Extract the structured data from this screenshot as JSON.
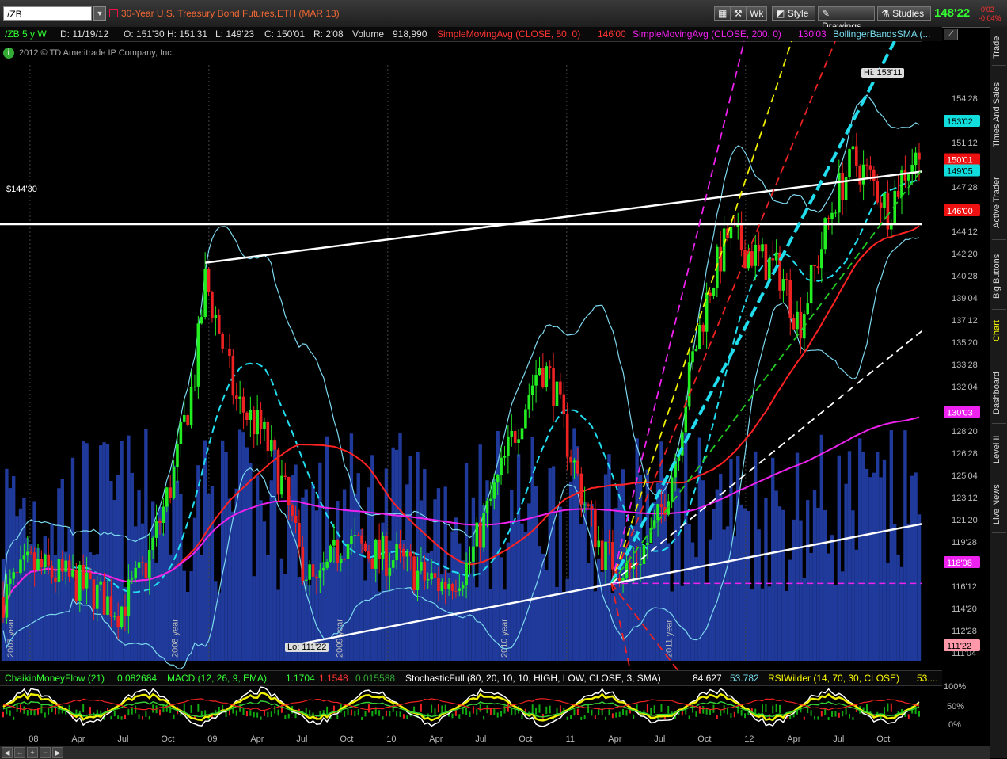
{
  "toolbar": {
    "symbol": "/ZB",
    "title": "30-Year U.S. Treasury Bond Futures,ETH (MAR 13)",
    "wk_label": "Wk",
    "style_label": "Style",
    "drawings_label": "Drawings",
    "studies_label": "Studies",
    "last_price": "148'22",
    "change_abs": "-0'02",
    "change_pct": "-0.04%"
  },
  "infobar": {
    "symbol_period": "/ZB 5 y W",
    "date": "D: 11/19/12",
    "open": "O: 151'30",
    "high": "H: 151'31",
    "low": "L: 149'23",
    "close": "C: 150'01",
    "range": "R: 2'08",
    "volume_label": "Volume",
    "volume_value": "918,990",
    "sma50_label": "SimpleMovingAvg (CLOSE, 50, 0)",
    "sma50_value": "146'00",
    "sma200_label": "SimpleMovingAvg (CLOSE, 200, 0)",
    "sma200_value": "130'03",
    "bb_label": "BollingerBandsSMA (...",
    "copyright": "2012 © TD Ameritrade IP Company, Inc."
  },
  "side_tabs": [
    "Trade",
    "Times And Sales",
    "Active Trader",
    "Big Buttons",
    "Chart",
    "Dashboard",
    "Level II",
    "Live News"
  ],
  "study_bar": {
    "cmf_label": "ChaikinMoneyFlow (21)",
    "cmf_value": "0.082684",
    "macd_label": "MACD (12, 26, 9, EMA)",
    "macd_value": "1.1704",
    "macd_avg": "1.1548",
    "macd_diff": "0.015588",
    "stoch_label": "StochasticFull (80, 20, 10, 10, HIGH, LOW, CLOSE, 3, SMA)",
    "stoch_k": "84.627",
    "stoch_d": "53.782",
    "rsi_label": "RSIWilder (14, 70, 30, CLOSE)",
    "rsi_value": "53...."
  },
  "lower_axis": [
    "100%",
    "50%",
    "0%"
  ],
  "colors": {
    "up_candle": "#22ee22",
    "down_candle": "#ee2222",
    "volume": "#1f3a9a",
    "sma50": "#ff2222",
    "sma200": "#ee22ee",
    "bollinger": "#7dd8ee",
    "trendline": "#ffffff"
  },
  "chart_data": {
    "type": "candlestick",
    "title": "30-Year U.S. Treasury Bond Futures,ETH (MAR 13)",
    "y_ticks": [
      "154'28",
      "153'02",
      "151'12",
      "149'20",
      "147'28",
      "146'04",
      "144'12",
      "142'20",
      "140'28",
      "139'04",
      "137'12",
      "135'20",
      "133'28",
      "132'04",
      "130'12",
      "128'20",
      "126'28",
      "125'04",
      "123'12",
      "121'20",
      "119'28",
      "118'04",
      "116'12",
      "114'20",
      "112'28",
      "111'04"
    ],
    "y_range": [
      110.5,
      157.5
    ],
    "x_ticks": [
      "08",
      "Apr",
      "Jul",
      "Oct",
      "09",
      "Apr",
      "Jul",
      "Oct",
      "10",
      "Apr",
      "Jul",
      "Oct",
      "11",
      "Apr",
      "Jul",
      "Oct",
      "12",
      "Apr",
      "Jul",
      "Oct"
    ],
    "year_labels": [
      "2007 year",
      "2008 year",
      "2009 year",
      "2010 year",
      "2011 year"
    ],
    "price_labels": {
      "hi": "Hi: 153'11",
      "lo": "Lo: 111'22",
      "horizontal_line": "$144'30",
      "bubble_153": "153'02",
      "bubble_150": "150'01",
      "bubble_149": "149'05",
      "bubble_146": "146'00",
      "bubble_130": "130'03",
      "bubble_118": "118'08",
      "bubble_111": "111'22"
    },
    "last_close": 150.03,
    "sma50_last": 146.0,
    "sma200_last": 130.1,
    "high_value": 153.34,
    "low_value": 111.69,
    "horizontal_line_value": 144.94,
    "close_anchors": [
      [
        2007.85,
        115.5
      ],
      [
        2008.0,
        118
      ],
      [
        2008.2,
        117
      ],
      [
        2008.35,
        116
      ],
      [
        2008.5,
        114.5
      ],
      [
        2008.65,
        118
      ],
      [
        2008.8,
        125
      ],
      [
        2008.92,
        133
      ],
      [
        2008.98,
        140.5
      ],
      [
        2009.05,
        137
      ],
      [
        2009.15,
        131
      ],
      [
        2009.3,
        128.5
      ],
      [
        2009.42,
        124
      ],
      [
        2009.5,
        119
      ],
      [
        2009.6,
        116
      ],
      [
        2009.75,
        120
      ],
      [
        2009.9,
        119
      ],
      [
        2010.05,
        118.5
      ],
      [
        2010.2,
        117
      ],
      [
        2010.3,
        116.5
      ],
      [
        2010.45,
        118
      ],
      [
        2010.6,
        124
      ],
      [
        2010.72,
        129
      ],
      [
        2010.85,
        134
      ],
      [
        2010.92,
        132.5
      ],
      [
        2011.0,
        128
      ],
      [
        2011.1,
        123
      ],
      [
        2011.2,
        119
      ],
      [
        2011.35,
        117.5
      ],
      [
        2011.5,
        121
      ],
      [
        2011.6,
        126
      ],
      [
        2011.7,
        134
      ],
      [
        2011.8,
        140
      ],
      [
        2011.9,
        144
      ],
      [
        2012.0,
        143
      ],
      [
        2012.1,
        142
      ],
      [
        2012.2,
        141
      ],
      [
        2012.3,
        137
      ],
      [
        2012.4,
        142
      ],
      [
        2012.5,
        147
      ],
      [
        2012.6,
        150
      ],
      [
        2012.7,
        148.5
      ],
      [
        2012.8,
        146
      ],
      [
        2012.88,
        149
      ],
      [
        2012.93,
        150.03
      ]
    ]
  }
}
